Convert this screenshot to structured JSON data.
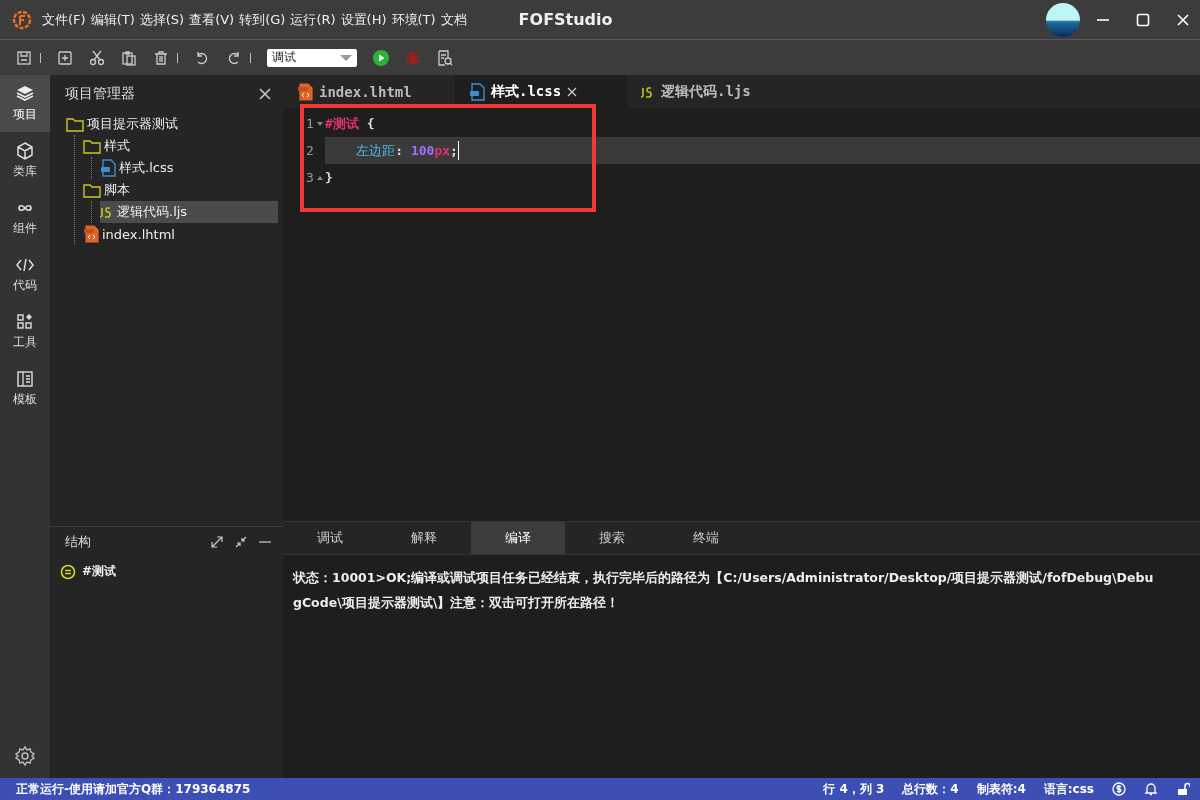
{
  "title_bar": {
    "menu": [
      "文件(F)",
      "编辑(T)",
      "选择(S)",
      "查看(V)",
      "转到(G)",
      "运行(R)",
      "设置(H)",
      "环境(T)",
      "文档"
    ],
    "title": "FOFStudio"
  },
  "toolbar": {
    "run_mode": "调试"
  },
  "activity_bar": {
    "items": [
      {
        "label": "项目",
        "kind": "layers",
        "selected": true
      },
      {
        "label": "类库",
        "kind": "cube",
        "selected": false
      },
      {
        "label": "组件",
        "kind": "infinity",
        "selected": false
      },
      {
        "label": "代码",
        "kind": "code",
        "selected": false
      },
      {
        "label": "工具",
        "kind": "widgets",
        "selected": false
      },
      {
        "label": "模板",
        "kind": "template",
        "selected": false
      }
    ]
  },
  "explorer": {
    "title": "项目管理器",
    "tree": [
      {
        "label": "项目提示器测试",
        "kind": "folder",
        "selected": false,
        "children": [
          {
            "label": "样式",
            "kind": "folder",
            "selected": false,
            "children": [
              {
                "label": "样式.lcss",
                "kind": "lcss",
                "selected": false
              }
            ]
          },
          {
            "label": "脚本",
            "kind": "folder",
            "selected": false,
            "children": [
              {
                "label": "逻辑代码.ljs",
                "kind": "ljs",
                "selected": true
              }
            ]
          },
          {
            "label": "index.lhtml",
            "kind": "lhtml",
            "selected": false
          }
        ]
      }
    ]
  },
  "structure": {
    "title": "结构",
    "items": [
      {
        "label": "#测试"
      }
    ]
  },
  "editor": {
    "tabs": [
      {
        "label": "index.lhtml",
        "kind": "lhtml",
        "selected": false
      },
      {
        "label": "样式.lcss",
        "kind": "lcss",
        "selected": true
      },
      {
        "label": "逻辑代码.ljs",
        "kind": "ljs",
        "selected": false
      }
    ],
    "highlight_box": true,
    "lines": [
      {
        "number": "1",
        "kind": "fold-start",
        "current": false,
        "tokens": [
          {
            "text": "#测试",
            "kind": "selector"
          },
          {
            "text": " {",
            "kind": "punct"
          }
        ]
      },
      {
        "number": "2",
        "kind": "plain",
        "current": true,
        "tokens": [
          {
            "text": "    左边距",
            "kind": "property"
          },
          {
            "text": ": ",
            "kind": "punct"
          },
          {
            "text": "100",
            "kind": "number"
          },
          {
            "text": "px",
            "kind": "unit"
          },
          {
            "text": ";",
            "kind": "punct"
          }
        ]
      },
      {
        "number": "3",
        "kind": "fold-end",
        "current": false,
        "tokens": [
          {
            "text": "}",
            "kind": "punct"
          }
        ]
      }
    ]
  },
  "output_panel": {
    "tabs": [
      {
        "label": "调试",
        "selected": false
      },
      {
        "label": "解释",
        "selected": false
      },
      {
        "label": "编译",
        "selected": true
      },
      {
        "label": "搜索",
        "selected": false
      },
      {
        "label": "终端",
        "selected": false
      }
    ],
    "message": "状态：10001>OK;编译或调试项目任务已经结束，执行完毕后的路径为【C:/Users/Administrator/Desktop/项目提示器测试/fofDebug\\DebugCode\\项目提示器测试\\】注意：双击可打开所在路径！"
  },
  "status_bar": {
    "message": "正常运行-使用请加官方Q群：179364875",
    "items": [
      "行 4，列 3",
      "总行数：4",
      "制表符:4",
      "语言:css"
    ]
  }
}
